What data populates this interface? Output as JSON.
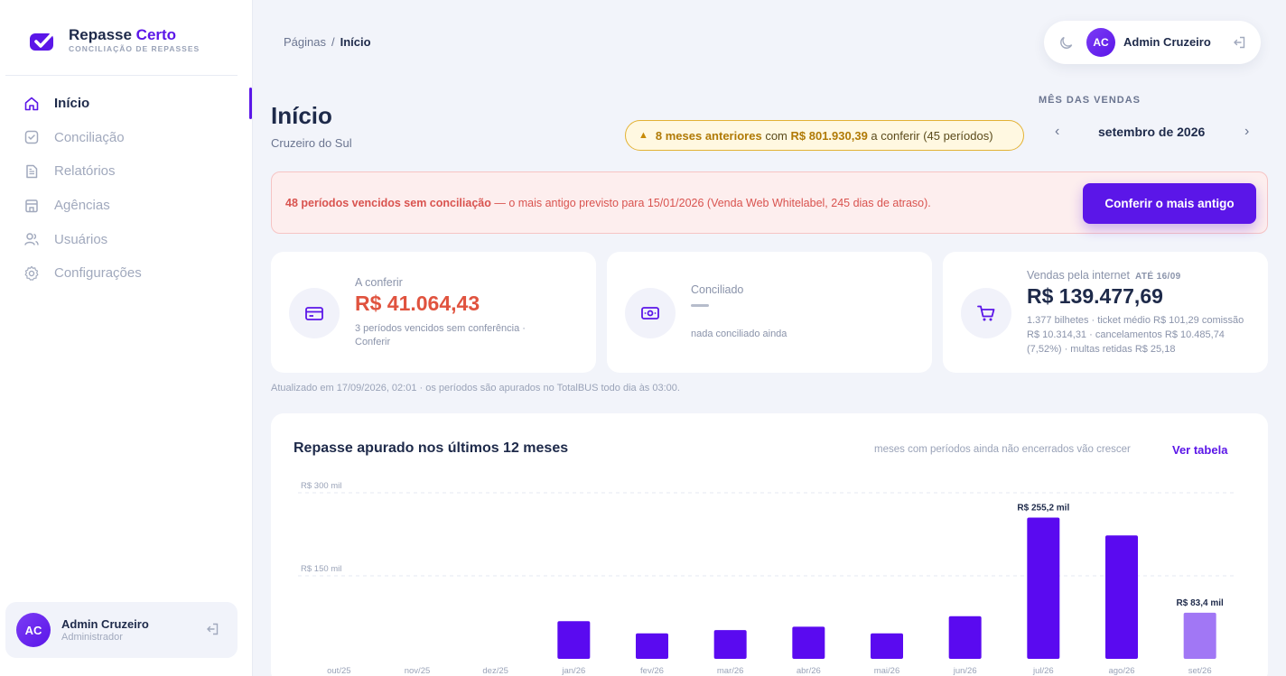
{
  "brand": {
    "name_part1": "Repasse",
    "name_part2": "Certo",
    "tagline": "CONCILIAÇÃO DE REPASSES"
  },
  "nav": [
    {
      "label": "Início",
      "icon": "home-icon",
      "active": true
    },
    {
      "label": "Conciliação",
      "icon": "check-square-icon"
    },
    {
      "label": "Relatórios",
      "icon": "document-icon"
    },
    {
      "label": "Agências",
      "icon": "building-icon"
    },
    {
      "label": "Usuários",
      "icon": "users-icon"
    },
    {
      "label": "Configurações",
      "icon": "gear-icon"
    }
  ],
  "user": {
    "initials": "AC",
    "name": "Admin Cruzeiro",
    "role": "Administrador"
  },
  "breadcrumb": {
    "parent": "Páginas",
    "separator": "/",
    "current": "Início"
  },
  "page": {
    "title": "Início",
    "subtitle": "Cruzeiro do Sul"
  },
  "warning": {
    "bold_part": "8 meses anteriores",
    "mid": "com",
    "amount": "R$ 801.930,39",
    "tail": "a conferir (45 períodos)"
  },
  "month": {
    "label": "MÊS DAS VENDAS",
    "value": "setembro de 2026",
    "prev": "‹",
    "next": "›"
  },
  "alert": {
    "bold": "48 períodos vencidos sem conciliação",
    "text": " — o mais antigo previsto para 15/01/2026 (Venda Web Whitelabel, 245 dias de atraso).",
    "button": "Conferir o mais antigo"
  },
  "stats": {
    "to_check": {
      "label": "A conferir",
      "value": "R$ 41.064,43",
      "note": "3 períodos vencidos sem conferência · Conferir"
    },
    "reconciled": {
      "label": "Conciliado",
      "note": "nada conciliado ainda"
    },
    "online": {
      "label": "Vendas pela internet",
      "badge": "ATÉ 16/09",
      "value": "R$ 139.477,69",
      "note": "1.377 bilhetes · ticket médio R$ 101,29 comissão R$ 10.314,31 · cancelamentos R$ 10.485,74 (7,52%) · multas retidas R$ 25,18"
    }
  },
  "updated": "Atualizado em 17/09/2026, 02:01 · os períodos são apurados no TotalBUS todo dia às 03:00.",
  "chart": {
    "title": "Repasse apurado nos últimos 12 meses",
    "hint": "meses com períodos ainda não encerrados vão crescer",
    "link": "Ver tabela"
  },
  "colors": {
    "accent": "#5b16e8",
    "bar": "#5a0af0",
    "bar_partial": "#a177f5",
    "danger": "#e0533f"
  },
  "chart_data": {
    "type": "bar",
    "categories": [
      "out/25",
      "nov/25",
      "dez/25",
      "jan/26",
      "fev/26",
      "mar/26",
      "abr/26",
      "mai/26",
      "jun/26",
      "jul/26",
      "ago/26",
      "set/26"
    ],
    "values": [
      0,
      0,
      0,
      68,
      46,
      52,
      58,
      46,
      77,
      255.2,
      223,
      83.4
    ],
    "unit": "R$ mil",
    "ylim": [
      0,
      300
    ],
    "yticks": [
      150,
      300
    ],
    "ytick_labels": [
      "R$ 150 mil",
      "R$ 300 mil"
    ],
    "data_labels": {
      "9": "R$ 255,2 mil",
      "11": "R$ 83,4 mil"
    },
    "partial_index": 11,
    "grid": true
  }
}
